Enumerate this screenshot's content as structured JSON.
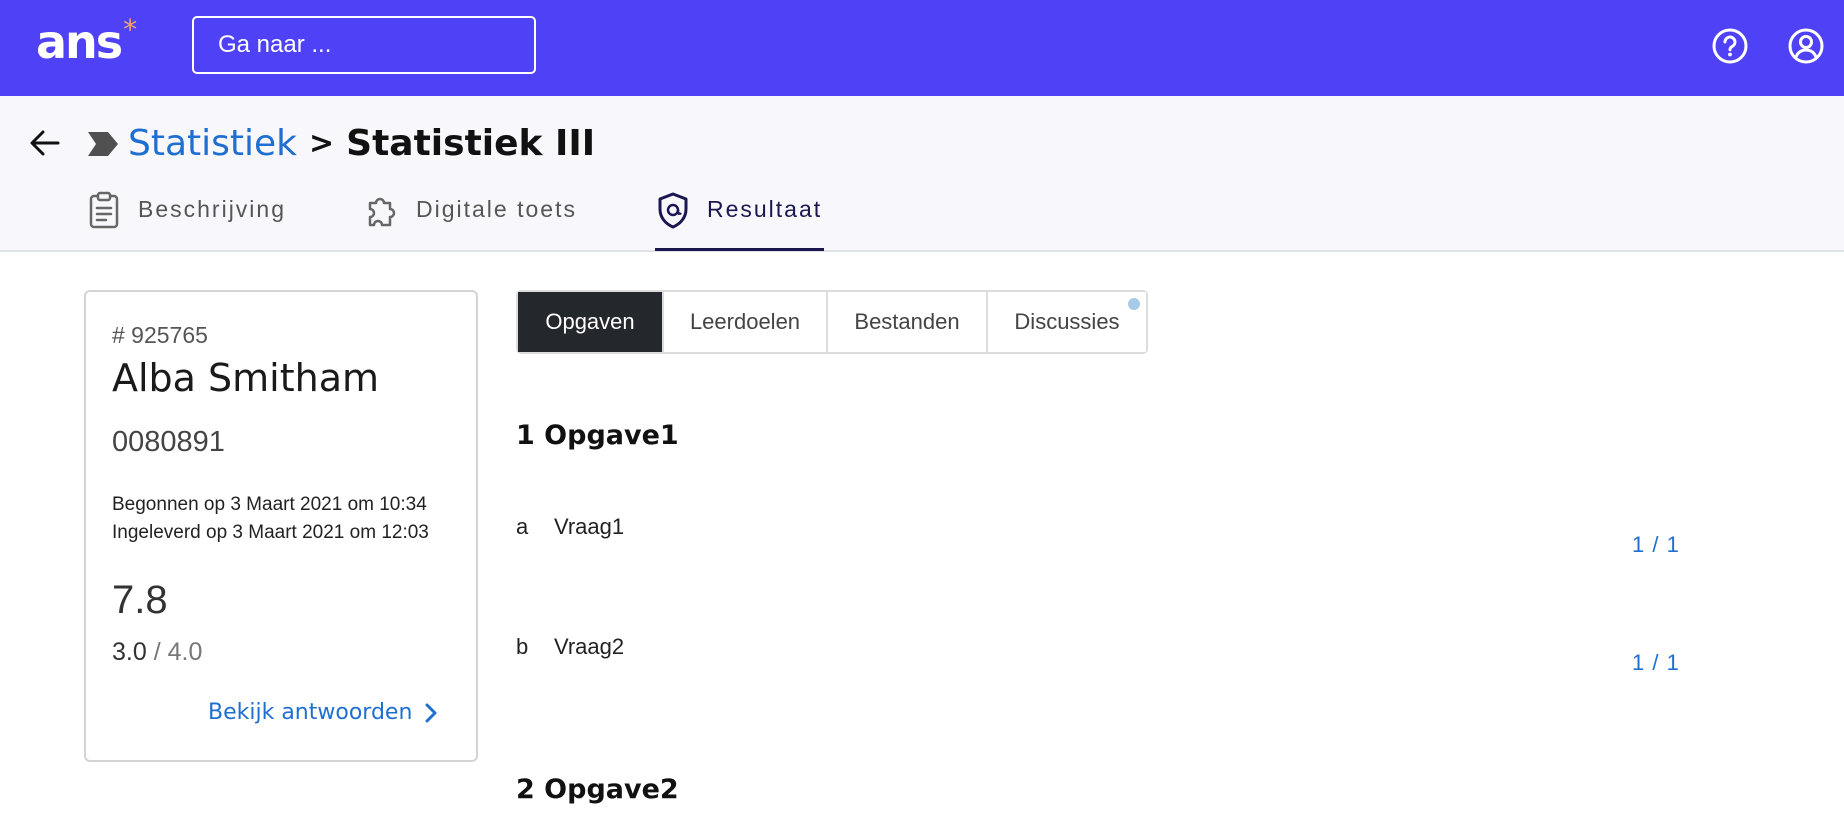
{
  "topbar": {
    "logo_text": "ans",
    "logo_mark": "*",
    "search_placeholder": "Ga naar ...",
    "help_icon": "question-circle-icon",
    "account_icon": "user-circle-icon",
    "colors": {
      "bar": "#4f42f6",
      "logo_accent": "#f5a36b"
    }
  },
  "header": {
    "breadcrumb": {
      "parent": "Statistiek",
      "separator": ">",
      "current": "Statistiek III"
    },
    "tabs": [
      {
        "label": "Beschrijving",
        "icon": "clipboard-icon"
      },
      {
        "label": "Digitale toets",
        "icon": "puzzle-icon"
      },
      {
        "label": "Resultaat",
        "icon": "shield-icon",
        "active": true
      }
    ]
  },
  "card": {
    "id": "# 925765",
    "name": "Alba Smitham",
    "student_number": "0080891",
    "started": "Begonnen op 3 Maart 2021 om 10:34",
    "submitted": "Ingeleverd op 3 Maart 2021 om 12:03",
    "grade": "7.8",
    "score": "3.0",
    "score_sep": " / ",
    "score_max": "4.0",
    "link": "Bekijk antwoorden"
  },
  "subtabs": [
    {
      "label": "Opgaven",
      "active": true
    },
    {
      "label": "Leerdoelen"
    },
    {
      "label": "Bestanden"
    },
    {
      "label": "Discussies",
      "badge": true
    }
  ],
  "sections": [
    {
      "title": "1 Opgave1",
      "questions": [
        {
          "letter": "a",
          "text": "Vraag1",
          "score": "1 / 1"
        },
        {
          "letter": "b",
          "text": "Vraag2",
          "score": "1 / 1"
        }
      ]
    },
    {
      "title": "2 Opgave2"
    }
  ]
}
